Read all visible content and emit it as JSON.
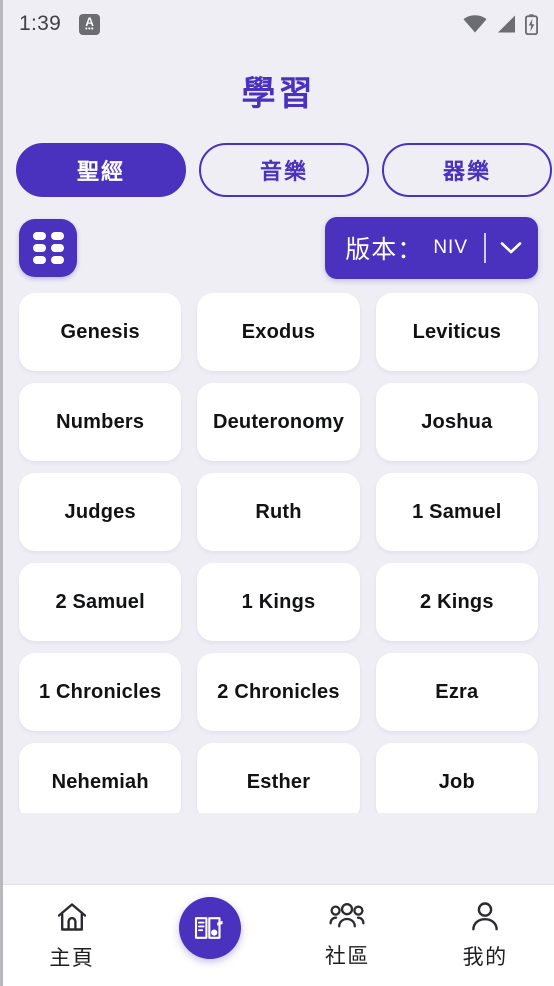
{
  "status_bar": {
    "time": "1:39",
    "badge_letter": "A",
    "badge_dots": "•••",
    "icons": [
      "wifi-icon",
      "cellular-signal-icon",
      "battery-charging-icon"
    ]
  },
  "header": {
    "title": "學習"
  },
  "tabs": [
    {
      "label": "聖經",
      "active": true
    },
    {
      "label": "音樂",
      "active": false
    },
    {
      "label": "器樂",
      "active": false
    },
    {
      "label": "",
      "active": false
    }
  ],
  "controls": {
    "grid_toggle": {
      "icon": "grid-list-icon"
    },
    "version": {
      "label": "版本：",
      "value": "NIV",
      "chevron": "chevron-down-icon"
    }
  },
  "books": [
    "Genesis",
    "Exodus",
    "Leviticus",
    "Numbers",
    "Deuteronomy",
    "Joshua",
    "Judges",
    "Ruth",
    "1 Samuel",
    "2 Samuel",
    "1 Kings",
    "2 Kings",
    "1 Chronicles",
    "2 Chronicles",
    "Ezra",
    "Nehemiah",
    "Esther",
    "Job",
    "",
    "",
    ""
  ],
  "bottom_nav": [
    {
      "label": "主頁",
      "icon": "home-icon",
      "active": false
    },
    {
      "label": "",
      "icon": "book-music-icon",
      "active": true
    },
    {
      "label": "社區",
      "icon": "community-people-icon",
      "active": false
    },
    {
      "label": "我的",
      "icon": "person-icon",
      "active": false
    }
  ],
  "colors": {
    "accent": "#4A32BE",
    "background": "#EFEEF5",
    "card": "#FFFFFF",
    "text": "#111214",
    "status_icon": "#6B6D72"
  }
}
